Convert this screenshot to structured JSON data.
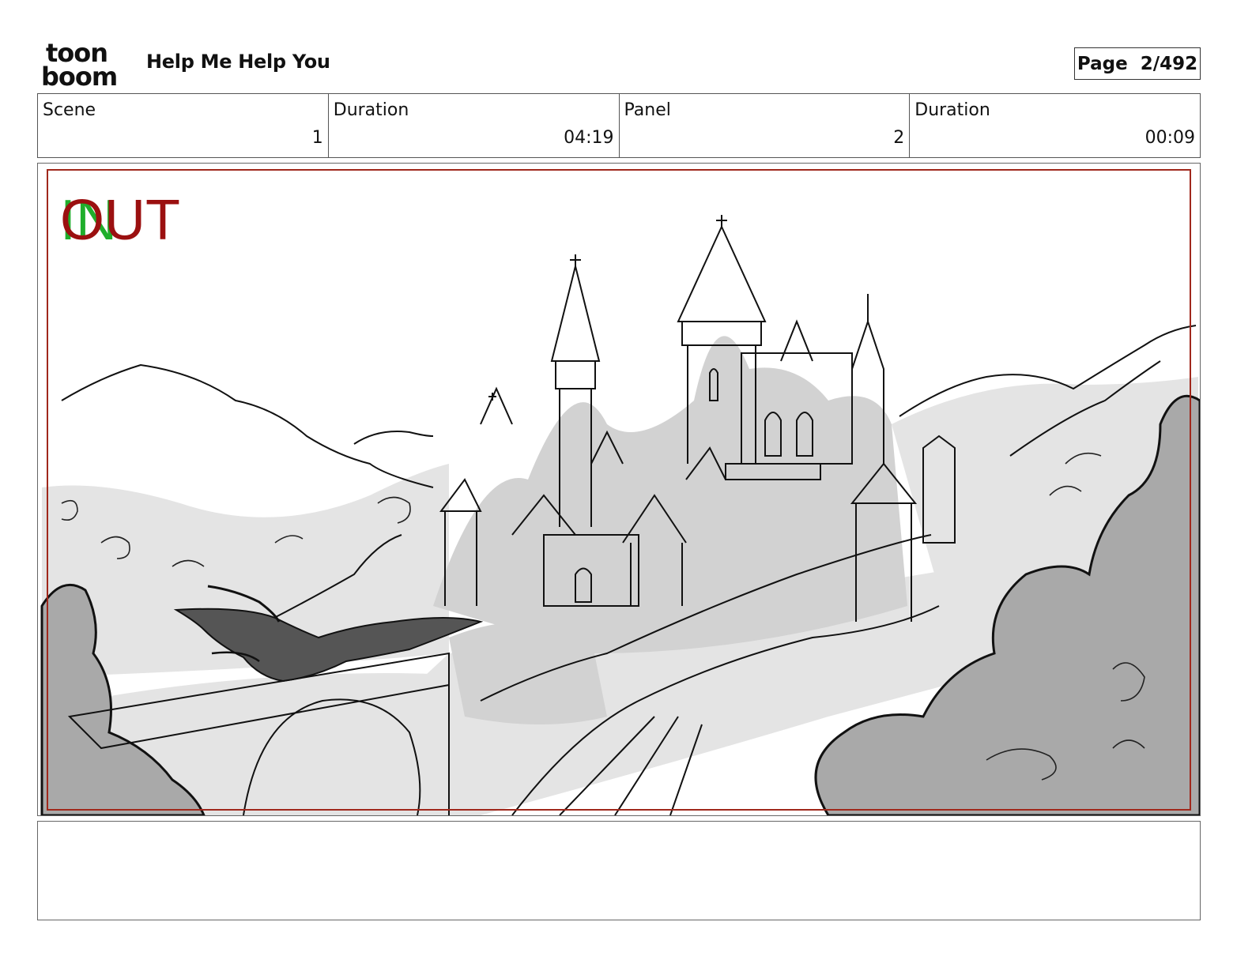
{
  "header": {
    "logo_top": "toon",
    "logo_bottom": "boom",
    "project_title": "Help Me Help You",
    "page_label": "Page",
    "page_number": "2/492"
  },
  "info": {
    "scene_label": "Scene",
    "scene_value": "1",
    "scene_duration_label": "Duration",
    "scene_duration_value": "04:19",
    "panel_label": "Panel",
    "panel_value": "2",
    "panel_duration_label": "Duration",
    "panel_duration_value": "00:09"
  },
  "panel": {
    "in_marker": "IN",
    "out_marker": "OUT",
    "in_color": "#1fae2c",
    "out_color": "#9b1010",
    "frame_color": "#a0281c"
  },
  "notes": {
    "text": ""
  }
}
